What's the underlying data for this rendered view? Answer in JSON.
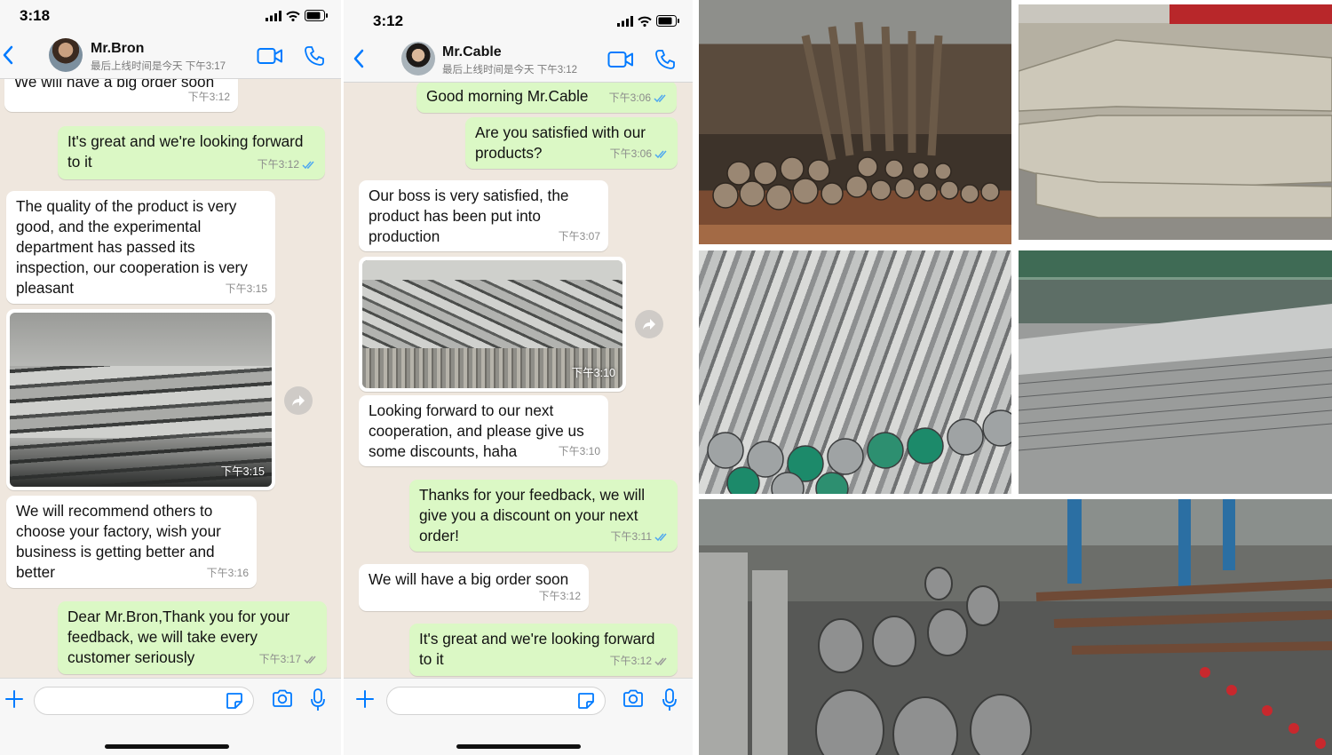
{
  "chat1": {
    "status_time": "3:18",
    "contact_name": "Mr.Bron",
    "last_seen": "最后上线时间是今天 下午3:17",
    "messages": [
      {
        "text": "We will have a big order soon",
        "time": "下午3:12"
      },
      {
        "text": "It's great and we're looking forward to it",
        "time": "下午3:12"
      },
      {
        "text": "The quality of the product is very good, and the experimental department has passed its inspection, our cooperation is very pleasant",
        "time": "下午3:15"
      },
      {
        "text": "",
        "time": "下午3:15"
      },
      {
        "text": "We will recommend others to choose your factory, wish your business is getting better and better",
        "time": "下午3:16"
      },
      {
        "text": "Dear Mr.Bron,Thank you for your feedback, we will take every customer seriously",
        "time": "下午3:17"
      }
    ]
  },
  "chat2": {
    "status_time": "3:12",
    "contact_name": "Mr.Cable",
    "last_seen": "最后上线时间是今天 下午3:12",
    "messages": [
      {
        "text": "Good morning Mr.Cable",
        "time": "下午3:06"
      },
      {
        "text": "Are you satisfied with our products?",
        "time": "下午3:06"
      },
      {
        "text": "Our boss is very satisfied, the product has been put into production",
        "time": "下午3:07"
      },
      {
        "text": "",
        "time": "下午3:10"
      },
      {
        "text": "Looking forward to our next cooperation, and please give us some discounts, haha",
        "time": "下午3:10"
      },
      {
        "text": "Thanks for your feedback, we will give you a discount on your next order!",
        "time": "下午3:11"
      },
      {
        "text": "We will have a big order soon",
        "time": "下午3:12"
      },
      {
        "text": "It's great and we're looking forward to it",
        "time": "下午3:12"
      }
    ]
  },
  "icons": [
    "back-chevron",
    "video-camera",
    "phone",
    "plus",
    "sticker",
    "camera",
    "microphone",
    "forward",
    "double-check",
    "signal",
    "wifi",
    "battery"
  ],
  "colors": {
    "chat_bg": "#efe7de",
    "incoming_bubble": "#ffffff",
    "outgoing_bubble": "#dbf8c5",
    "ios_blue": "#007aff",
    "read_check": "#4fa8f0"
  }
}
